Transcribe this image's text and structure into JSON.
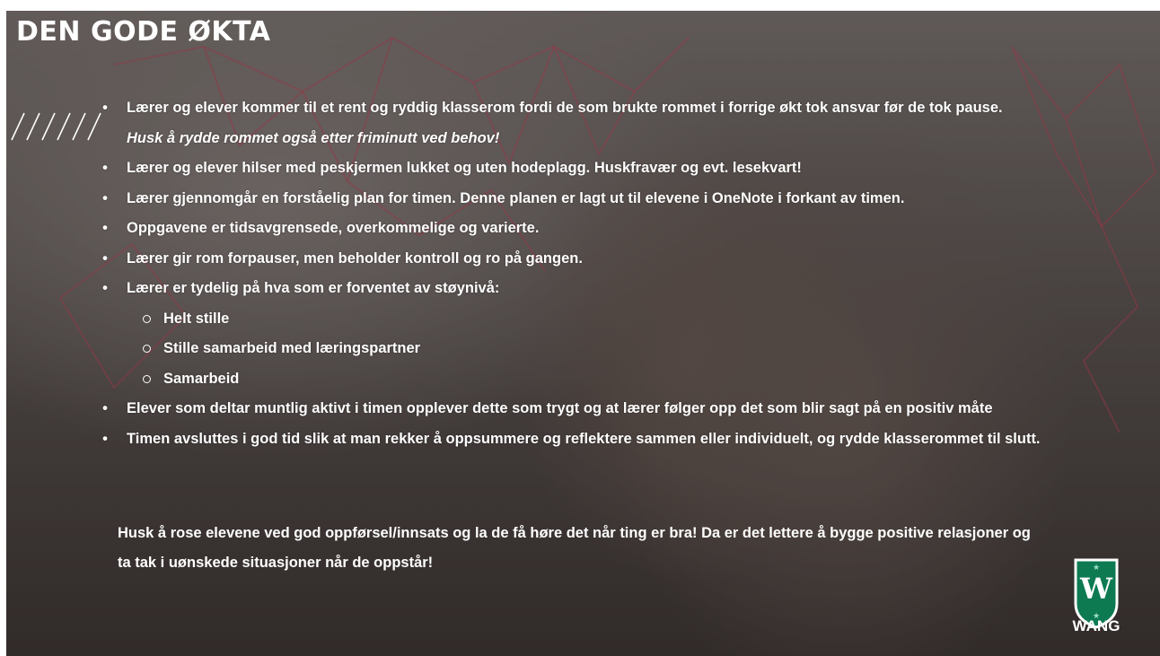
{
  "slide": {
    "title": "DEN GODE ØKTA",
    "bullets": [
      {
        "text": "Lærer og elever kommer til et rent og ryddig klasserom fordi de som brukte rommet i forrige økt tok ansvar før de tok pause.",
        "note": "Husk å rydde rommet også etter friminutt ved behov!"
      },
      {
        "text": "Lærer og elever hilser med peskjermen lukket og uten hodeplagg. Huskfravær og evt. lesekvart!"
      },
      {
        "text": "Lærer gjennomgår en forståelig plan for timen. Denne planen er lagt ut til elevene i OneNote i forkant av timen."
      },
      {
        "text": "Oppgavene er tidsavgrensede, overkommelige og varierte."
      },
      {
        "text": "Lærer gir rom forpauser, men beholder kontroll og ro på gangen."
      },
      {
        "text": "Lærer er tydelig på hva som er forventet av støynivå:",
        "subitems": [
          "Helt stille",
          "Stille samarbeid med læringspartner",
          "Samarbeid"
        ]
      },
      {
        "text": "Elever som deltar muntlig aktivt i timen opplever dette som trygt og at lærer følger opp det som blir sagt på en positiv måte"
      },
      {
        "text": "Timen avsluttes i god tid slik at man rekker å oppsummere og reflektere sammen eller individuelt, og rydde klasserommet til slutt."
      }
    ],
    "closing_line1": "Husk å rose elevene ved god oppførsel/innsats og la de få høre det når ting er bra! Da er det lettere å bygge positive relasjoner og",
    "closing_line2": "ta tak i uønskede situasjoner når de oppstår!"
  },
  "logo": {
    "letter": "W",
    "name": "WANG",
    "colors": {
      "shield": "#0d7a52",
      "border": "#ffffff",
      "letter": "#ffffff"
    }
  },
  "colors": {
    "text": "#ffffff",
    "net_lines": "#c8485a"
  },
  "icons": {
    "bullet": "bullet-dot-icon",
    "sub_bullet": "hollow-circle-icon",
    "decoration": "diagonal-slashes-icon"
  }
}
